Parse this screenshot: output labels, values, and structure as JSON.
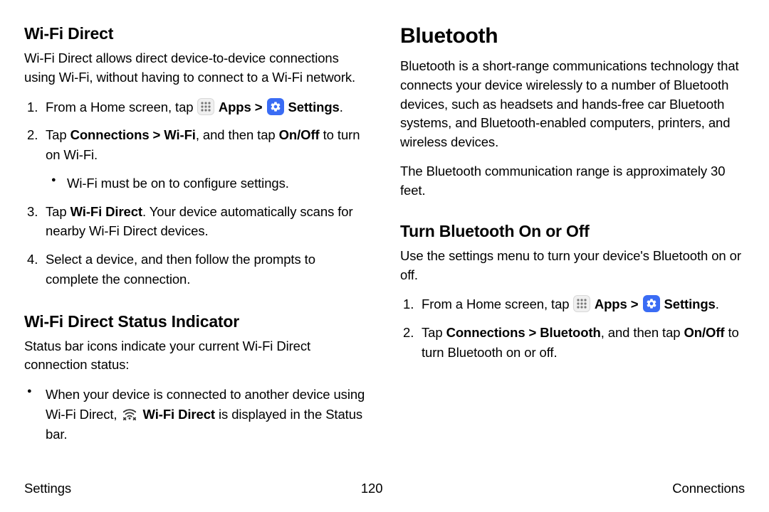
{
  "left": {
    "h2a": "Wi-Fi Direct",
    "intro": "Wi-Fi Direct allows direct device-to-device connections using Wi-Fi, without having to connect to a Wi-Fi network.",
    "step1_a": "From a Home screen, tap ",
    "apps_label": " Apps",
    "arrow": " > ",
    "settings_label": " Settings",
    "period": ".",
    "step2_a": "Tap ",
    "step2_b": "Connections > Wi-Fi",
    "step2_c": ", and then tap ",
    "step2_d": "On/Off",
    "step2_e": " to turn on Wi-Fi.",
    "step2_sub": "Wi-Fi must be on to configure settings.",
    "step3_a": "Tap ",
    "step3_b": "Wi-Fi Direct",
    "step3_c": ". Your device automatically scans for nearby Wi-Fi Direct devices.",
    "step4": "Select a device, and then follow the prompts to complete the connection.",
    "h2b": "Wi-Fi Direct Status Indicator",
    "status_intro": "Status bar icons indicate your current Wi-Fi Direct connection status:",
    "bullet_a": "When your device is connected to another device using Wi-Fi Direct, ",
    "bullet_b": " Wi-Fi Direct",
    "bullet_c": " is displayed in the Status bar."
  },
  "right": {
    "h1": "Bluetooth",
    "intro": "Bluetooth is a short-range communications technology that connects your device wirelessly to a number of Bluetooth devices, such as headsets and hands-free car Bluetooth systems, and Bluetooth-enabled computers, printers, and wireless devices.",
    "range": "The Bluetooth communication range is approximately 30 feet.",
    "h2": "Turn Bluetooth On or Off",
    "use": "Use the settings menu to turn your device's Bluetooth on or off.",
    "step1_a": "From a Home screen, tap ",
    "step2_a": "Tap ",
    "step2_b": "Connections > Bluetooth",
    "step2_c": ", and then tap ",
    "step2_d": "On/Off",
    "step2_e": " to turn Bluetooth on or off."
  },
  "footer": {
    "left": "Settings",
    "center": "120",
    "right": "Connections"
  }
}
